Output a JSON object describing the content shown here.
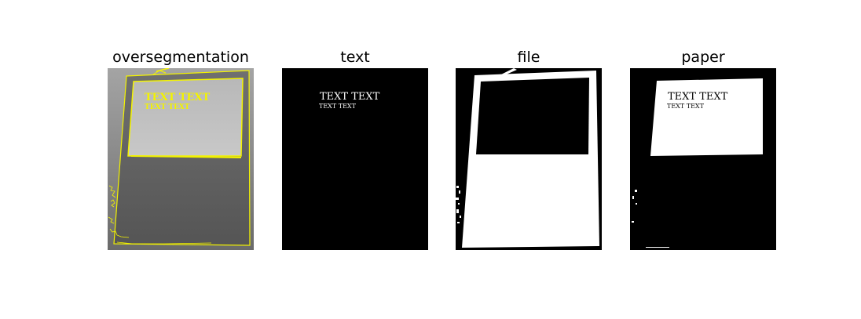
{
  "figure": {
    "panels": [
      {
        "title": "oversegmentation"
      },
      {
        "title": "text"
      },
      {
        "title": "file"
      },
      {
        "title": "paper"
      }
    ],
    "image_text": "TEXT TEXT"
  },
  "colors": {
    "boundary": "#f3f300",
    "gray_photo": "#8a8a8a",
    "mask_fg": "#ffffff",
    "mask_bg": "#000000"
  }
}
